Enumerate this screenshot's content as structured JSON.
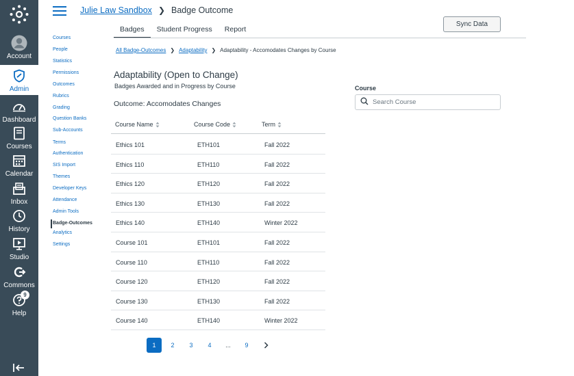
{
  "global_nav": {
    "items": [
      {
        "label": "Account",
        "icon": "account-icon"
      },
      {
        "label": "Admin",
        "icon": "admin-shield-icon"
      },
      {
        "label": "Dashboard",
        "icon": "dashboard-icon"
      },
      {
        "label": "Courses",
        "icon": "courses-icon"
      },
      {
        "label": "Calendar",
        "icon": "calendar-icon"
      },
      {
        "label": "Inbox",
        "icon": "inbox-icon"
      },
      {
        "label": "History",
        "icon": "history-clock-icon"
      },
      {
        "label": "Studio",
        "icon": "studio-icon"
      },
      {
        "label": "Commons",
        "icon": "commons-icon"
      },
      {
        "label": "Help",
        "icon": "help-icon"
      }
    ],
    "help_badge": "9",
    "active_color": "#0b6cc2",
    "bg_color": "#394b58"
  },
  "header": {
    "crumb_link": "Julie Law Sandbox",
    "crumb_current": "Badge Outcome",
    "sync_label": "Sync Data"
  },
  "tabs": [
    {
      "label": "Badges",
      "active": true
    },
    {
      "label": "Student Progress",
      "active": false
    },
    {
      "label": "Report",
      "active": false
    }
  ],
  "subnav": [
    "Courses",
    "People",
    "Statistics",
    "Permissions",
    "Outcomes",
    "Rubrics",
    "Grading",
    "Question Banks",
    "Sub-Accounts",
    "Terms",
    "Authentication",
    "SIS Import",
    "Themes",
    "Developer Keys",
    "Attendance",
    "Admin Tools",
    "Badge-Outcomes",
    "Analytics",
    "Settings"
  ],
  "subnav_active": "Badge-Outcomes",
  "breadcrumb": {
    "link1": "All Badge-Outcomes",
    "link2": "Adaptability",
    "current": "Adaptability - Accomodates Changes by Course"
  },
  "page": {
    "title": "Adaptability (Open to Change)",
    "subtitle": "Badges Awarded and in Progress by Course",
    "outcome": "Outcome: Accomodates Changes"
  },
  "table": {
    "headers": [
      "Course Name",
      "Course Code",
      "Term"
    ],
    "rows": [
      [
        "Ethics 101",
        "ETH101",
        "Fall 2022"
      ],
      [
        "Ethics 110",
        "ETH110",
        "Fall 2022"
      ],
      [
        "Ethics 120",
        "ETH120",
        "Fall 2022"
      ],
      [
        "Ethics 130",
        "ETH130",
        "Fall 2022"
      ],
      [
        "Ethics 140",
        "ETH140",
        "Winter 2022"
      ],
      [
        "Course 101",
        "ETH101",
        "Fall 2022"
      ],
      [
        "Course 110",
        "ETH110",
        "Fall 2022"
      ],
      [
        "Course 120",
        "ETH120",
        "Fall 2022"
      ],
      [
        "Course 130",
        "ETH130",
        "Fall 2022"
      ],
      [
        "Course 140",
        "ETH140",
        "Winter 2022"
      ]
    ]
  },
  "pagination": {
    "pages": [
      "1",
      "2",
      "3",
      "4",
      "...",
      "9"
    ],
    "current": "1",
    "next_icon": "chevron-right-icon"
  },
  "course_filter": {
    "label": "Course",
    "placeholder": "Search Course"
  }
}
